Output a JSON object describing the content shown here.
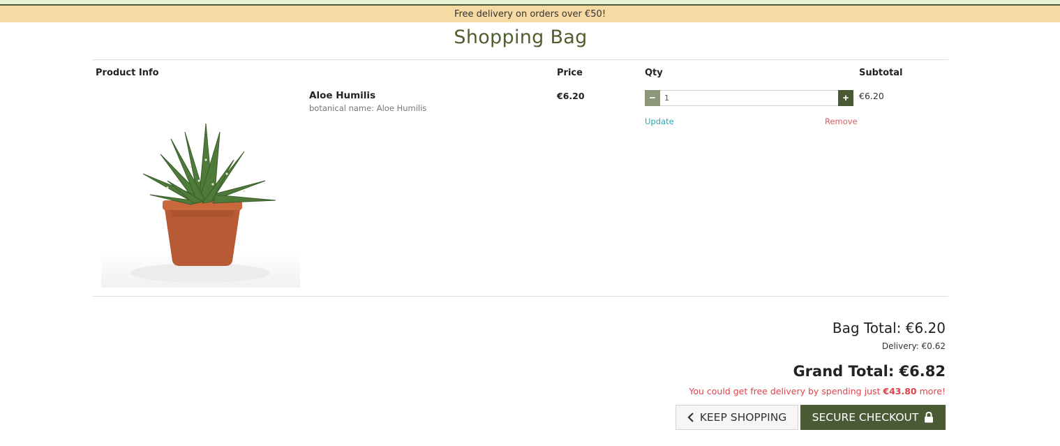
{
  "banner": {
    "text": "Free delivery on orders over €50!"
  },
  "page": {
    "title": "Shopping Bag"
  },
  "table": {
    "headers": {
      "product_info": "Product Info",
      "price": "Price",
      "qty": "Qty",
      "subtotal": "Subtotal"
    },
    "items": [
      {
        "name": "Aloe Humilis",
        "botanical": "botanical name: Aloe Humilis",
        "price": "€6.20",
        "qty": "1",
        "subtotal": "€6.20",
        "update_label": "Update",
        "remove_label": "Remove",
        "minus_label": "−",
        "plus_label": "+"
      }
    ]
  },
  "totals": {
    "bag_total": "Bag Total: €6.20",
    "delivery": "Delivery: €0.62",
    "grand_total": "Grand Total: €6.82",
    "free_delivery_prefix": "You could get free delivery by spending just ",
    "free_delivery_amount": "€43.80",
    "free_delivery_suffix": " more!"
  },
  "actions": {
    "keep_shopping": "KEEP SHOPPING",
    "secure_checkout": "SECURE CHECKOUT"
  },
  "icons": {
    "keep_shopping": "chevron-left-icon",
    "secure_checkout": "lock-icon"
  },
  "colors": {
    "brand_green": "#4a5a34",
    "banner_bg": "#f7d9a3",
    "title_green": "#4f5d2f",
    "update_link": "#2aa6b5",
    "remove_link": "#e05a5a",
    "free_note": "#e0424b"
  }
}
